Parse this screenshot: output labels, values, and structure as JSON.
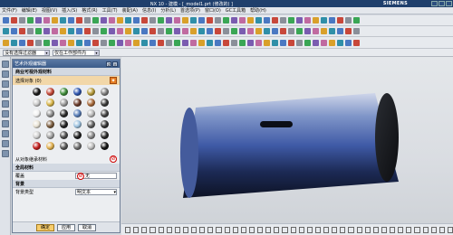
{
  "window": {
    "title": "NX 10 - 建模 - [_model1.prt (修改的) ]",
    "brand": "SIEMENS"
  },
  "menu": {
    "items": [
      "文件(F)",
      "编辑(E)",
      "视图(V)",
      "插入(S)",
      "格式(R)",
      "工具(T)",
      "装配(A)",
      "信息(I)",
      "分析(L)",
      "首选项(P)",
      "窗口(O)",
      "GC工具箱",
      "帮助(H)"
    ]
  },
  "filters": {
    "type_filter": "没有选择过滤器",
    "scope": "仅在工作部件内"
  },
  "dialog": {
    "title": "艺术外观编辑器",
    "section_material": "商业可视外观材料",
    "select_object_label": "选择对象 (0)",
    "inherit_label": "从对象继承材料",
    "section_global": "全局材料",
    "override_label": "覆盖",
    "override_value": "无",
    "section_bg": "背景",
    "bg_type_label": "背景类型",
    "bg_type_value": "明文本",
    "ok": "确定",
    "apply": "应用",
    "cancel": "取消"
  },
  "materials": [
    "#1a1a1a",
    "#c44838",
    "#3f8c3a",
    "#2f56b0",
    "#b59a3a",
    "#7d7d7d",
    "#c9c9c9",
    "#d8b54a",
    "#9a9a9a",
    "#6b3c2b",
    "#a86a3b",
    "#3a3a3a",
    "#f0f0f0",
    "#8d8d8d",
    "#2b2b2b",
    "#5a7fb9",
    "#b9b9b9",
    "#444444",
    "#e8e2d4",
    "#7a5c3e",
    "#222222",
    "#9ec3e0",
    "#5f5f5f",
    "#333333",
    "#d0d0d0",
    "#a0a0a0",
    "#4c4c4c",
    "#1e1e1e",
    "#888888",
    "#2a2a2a",
    "#c21f1f",
    "#e0b050",
    "#555555",
    "#6d6d6d",
    "#bdbdbd",
    "#141414"
  ],
  "colors": {
    "accent": "#3c5c8a",
    "ok_button": "#f7cd6c",
    "select_highlight": "#f2d7a8"
  }
}
